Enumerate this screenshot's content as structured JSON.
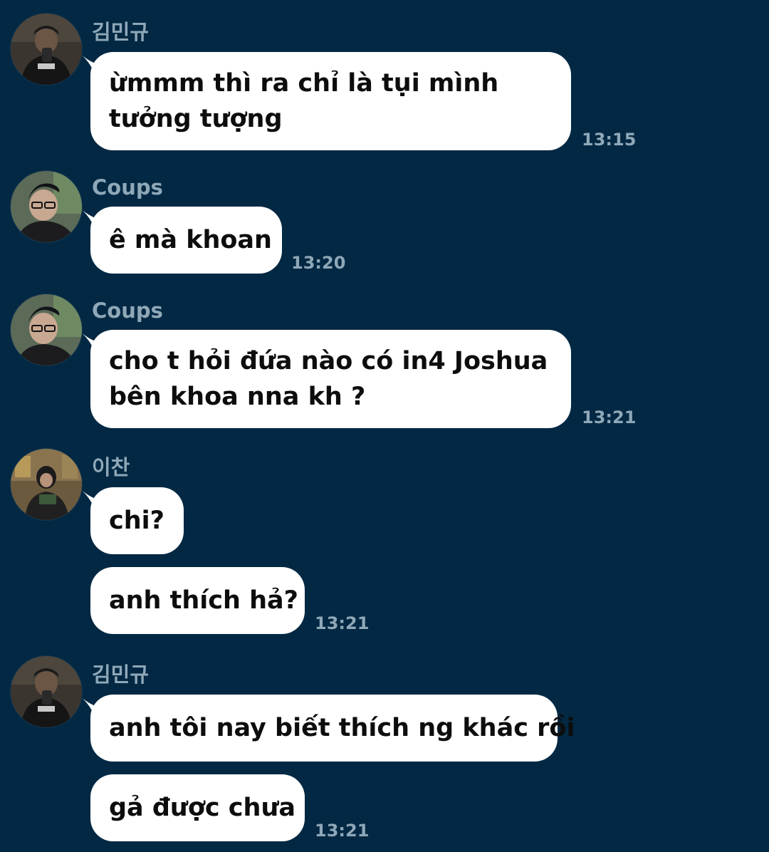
{
  "colors": {
    "background": "#022843",
    "bubble": "#ffffff",
    "meta_text": "#8fa8b8",
    "message_text": "#0d0d0d"
  },
  "messages": [
    {
      "sender": "김민규",
      "text": "ừmmm thì ra chỉ là tụi mình tưởng tượng",
      "time": "13:15"
    },
    {
      "sender": "Coups",
      "text": "ê mà khoan",
      "time": "13:20"
    },
    {
      "sender": "Coups",
      "text": "cho t hỏi đứa nào có in4 Joshua bên khoa nna kh ?",
      "time": "13:21"
    },
    {
      "sender": "이찬",
      "texts": [
        "chi?",
        "anh thích hả?"
      ],
      "time": "13:21"
    },
    {
      "sender": "김민규",
      "texts": [
        "anh tôi nay biết thích ng khác rồi",
        "gả được chưa"
      ],
      "time": "13:21"
    }
  ]
}
